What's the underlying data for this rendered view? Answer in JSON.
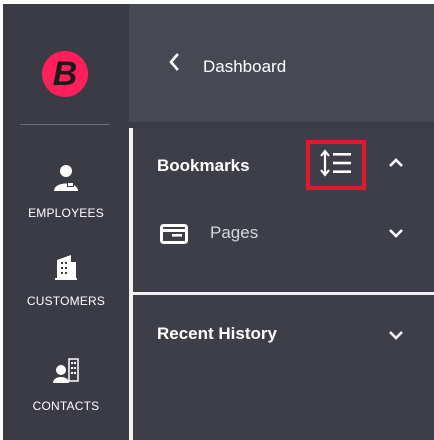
{
  "logo": {
    "letter": "B",
    "color": "#ff1f5a"
  },
  "rail": {
    "items": [
      {
        "label": "EMPLOYEES",
        "icon": "employee-icon"
      },
      {
        "label": "CUSTOMERS",
        "icon": "building-icon"
      },
      {
        "label": "CONTACTS",
        "icon": "contacts-icon"
      }
    ]
  },
  "header": {
    "back_icon": "chevron-left-icon",
    "title": "Dashboard"
  },
  "bookmarks": {
    "title": "Bookmarks",
    "sort_icon": "sort-list-icon",
    "collapse_icon": "chevron-up-icon",
    "pages": {
      "label": "Pages",
      "icon": "window-icon",
      "expand_icon": "chevron-down-icon"
    }
  },
  "recent_history": {
    "title": "Recent History",
    "expand_icon": "chevron-down-icon"
  },
  "colors": {
    "panel": "#3d3e47",
    "header": "#464852",
    "highlight": "#e0192b"
  }
}
